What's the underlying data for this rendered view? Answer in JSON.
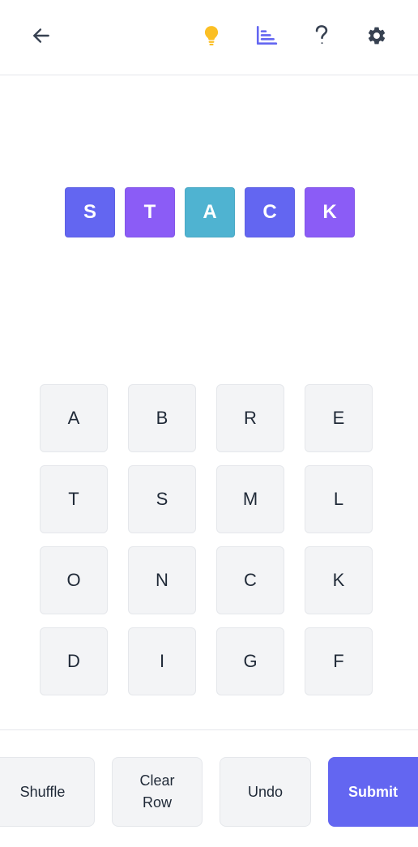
{
  "header": {
    "icons": [
      "back-arrow-icon",
      "lightbulb-icon",
      "stats-chart-icon",
      "question-mark-icon",
      "gear-icon"
    ],
    "colors": {
      "default": "#374151",
      "hint": "#fbbf24",
      "stats": "#6366f1"
    }
  },
  "word": {
    "letters": [
      {
        "letter": "S",
        "color": "#6366f1"
      },
      {
        "letter": "T",
        "color": "#8b5cf6"
      },
      {
        "letter": "A",
        "color": "#4fb3d1"
      },
      {
        "letter": "C",
        "color": "#6366f1"
      },
      {
        "letter": "K",
        "color": "#8b5cf6"
      }
    ]
  },
  "grid": {
    "letters": [
      "A",
      "B",
      "R",
      "E",
      "T",
      "S",
      "M",
      "L",
      "O",
      "N",
      "C",
      "K",
      "D",
      "I",
      "G",
      "F"
    ]
  },
  "footer": {
    "shuffle_label": "Shuffle",
    "clear_row_label": "Clear Row",
    "undo_label": "Undo",
    "submit_label": "Submit",
    "submit_color": "#6366f1"
  }
}
